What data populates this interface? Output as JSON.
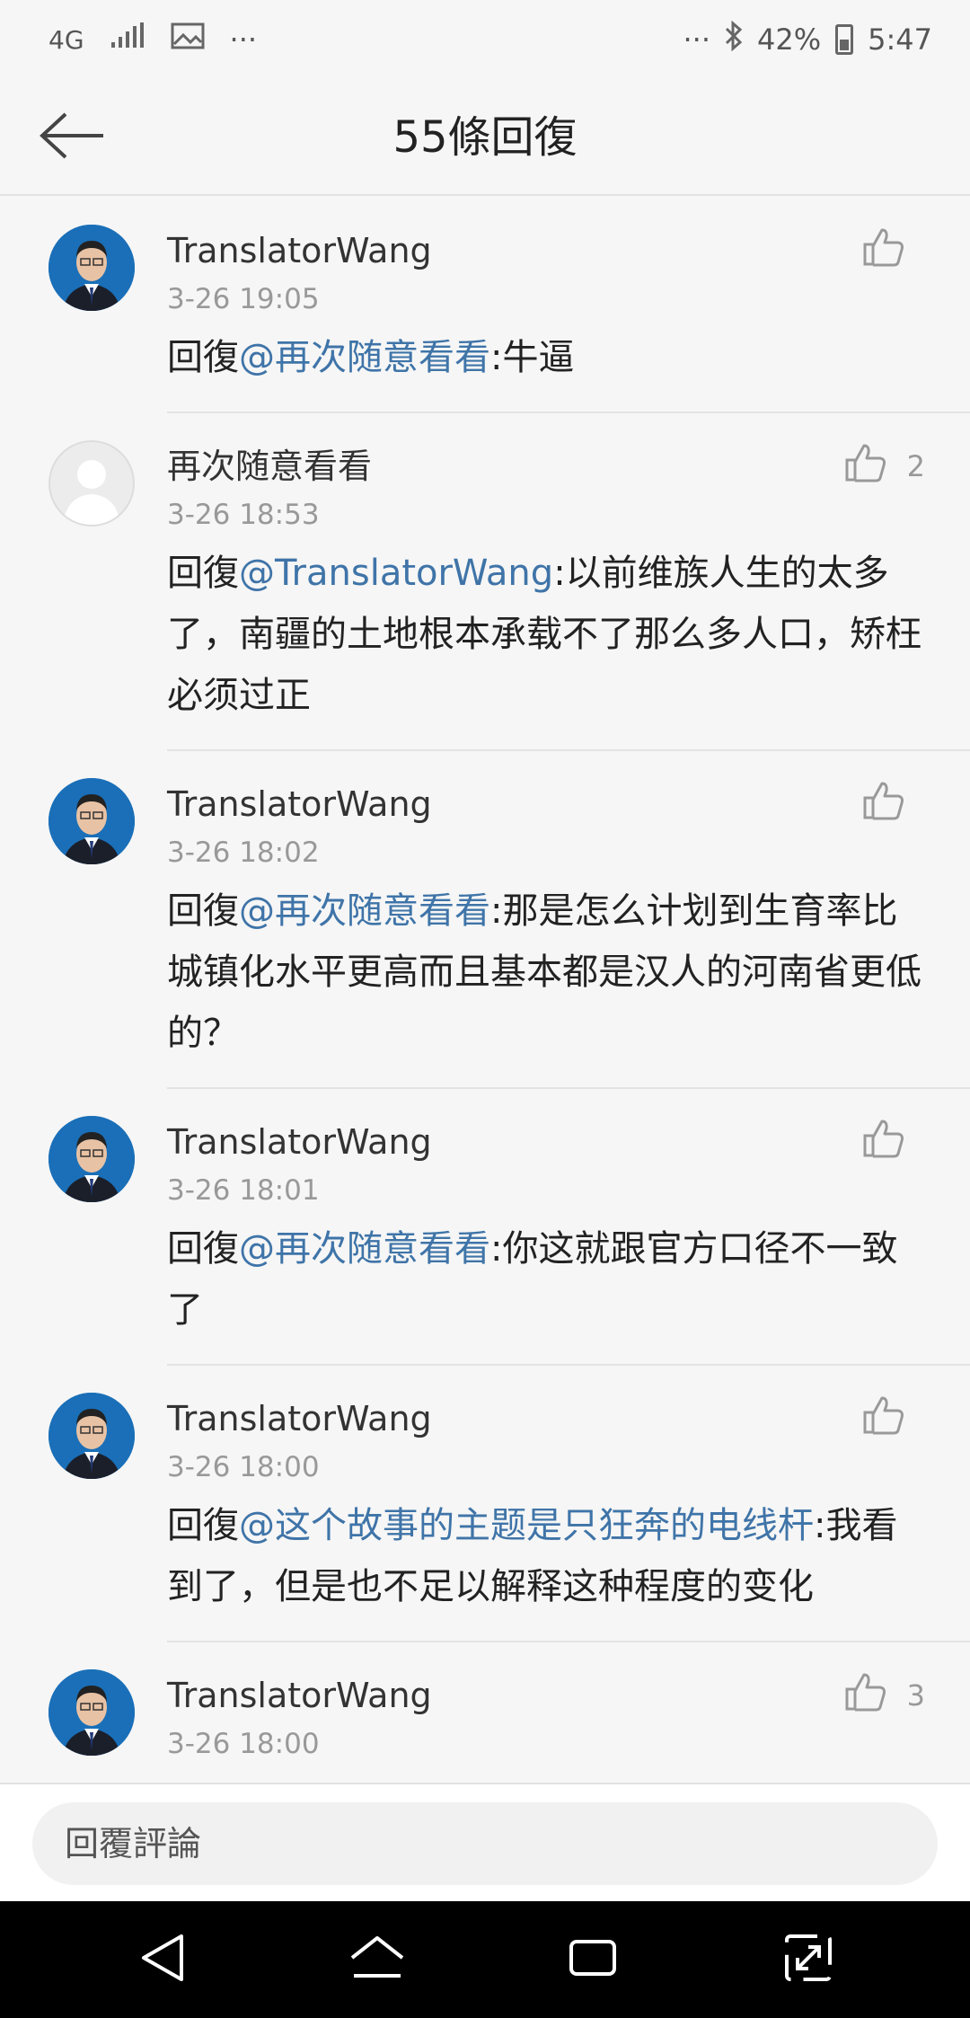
{
  "status_bar": {
    "network": "4G",
    "dots_left": "···",
    "dots_right": "···",
    "battery": "42%",
    "time": "5:47"
  },
  "header": {
    "title": "55條回復"
  },
  "comments": [
    {
      "username": "TranslatorWang",
      "time": "3-26 19:05",
      "reply_prefix": "回復",
      "mention": "@再次随意看看",
      "text": ":牛逼",
      "likes": "",
      "avatar": "photo"
    },
    {
      "username": "再次随意看看",
      "time": "3-26 18:53",
      "reply_prefix": "回復",
      "mention": "@TranslatorWang",
      "text": ":以前维族人生的太多了，南疆的土地根本承载不了那么多人口，矫枉必须过正",
      "likes": "2",
      "avatar": "blank"
    },
    {
      "username": "TranslatorWang",
      "time": "3-26 18:02",
      "reply_prefix": "回復",
      "mention": "@再次随意看看",
      "text": ":那是怎么计划到生育率比城镇化水平更高而且基本都是汉人的河南省更低的？",
      "likes": "",
      "avatar": "photo"
    },
    {
      "username": "TranslatorWang",
      "time": "3-26 18:01",
      "reply_prefix": "回復",
      "mention": "@再次随意看看",
      "text": ":你这就跟官方口径不一致了",
      "likes": "",
      "avatar": "photo"
    },
    {
      "username": "TranslatorWang",
      "time": "3-26 18:00",
      "reply_prefix": "回復",
      "mention": "@这个故事的主题是只狂奔的电线杆",
      "text": ":我看到了，但是也不足以解释这种程度的变化",
      "likes": "",
      "avatar": "photo"
    },
    {
      "username": "TranslatorWang",
      "time": "3-26 18:00",
      "reply_prefix": "",
      "mention": "",
      "text": "",
      "likes": "3",
      "avatar": "photo"
    }
  ],
  "reply_bar": {
    "placeholder": "回覆評論"
  },
  "colors": {
    "mention": "#3f74a8",
    "avatar_bg": "#1a6fb8"
  },
  "icons": {
    "back": "arrow-left-icon",
    "like": "thumbs-up-icon",
    "nav_back": "triangle-back-icon",
    "nav_home": "home-icon",
    "nav_recent": "recent-apps-icon",
    "nav_expand": "expand-icon"
  }
}
